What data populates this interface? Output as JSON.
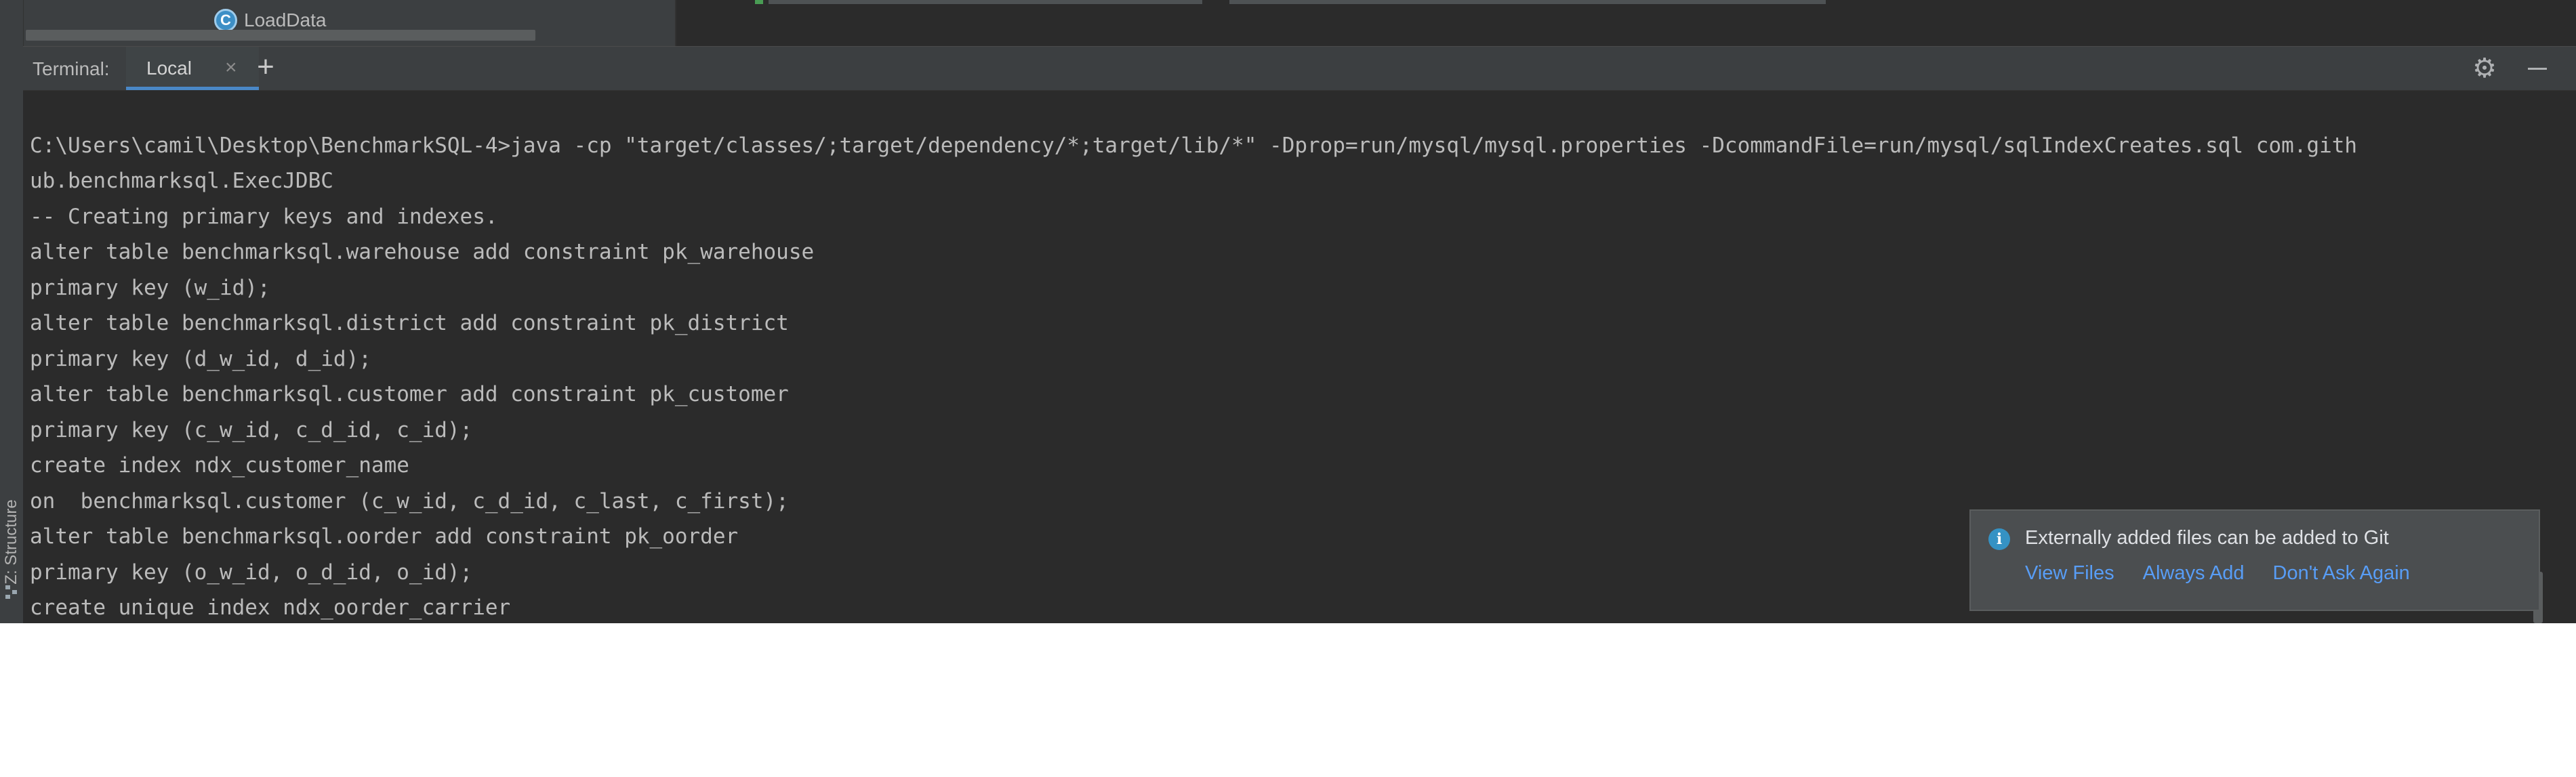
{
  "project_tree": {
    "item_label": "LoadData",
    "item_icon": "class-icon"
  },
  "tool_window": {
    "title": "Terminal:",
    "tabs": [
      {
        "label": "Local",
        "close_glyph": "×"
      }
    ],
    "add_tab_glyph": "+",
    "settings_icon": "gear-icon",
    "minimize_icon": "minimize-icon"
  },
  "terminal": {
    "lines": [
      "C:\\Users\\camil\\Desktop\\BenchmarkSQL-4>java -cp \"target/classes/;target/dependency/*;target/lib/*\" -Dprop=run/mysql/mysql.properties -DcommandFile=run/mysql/sqlIndexCreates.sql com.gith",
      "ub.benchmarksql.ExecJDBC",
      "-- Creating primary keys and indexes.",
      "alter table benchmarksql.warehouse add constraint pk_warehouse",
      "primary key (w_id);",
      "alter table benchmarksql.district add constraint pk_district",
      "primary key (d_w_id, d_id);",
      "alter table benchmarksql.customer add constraint pk_customer",
      "primary key (c_w_id, c_d_id, c_id);",
      "create index ndx_customer_name",
      "on  benchmarksql.customer (c_w_id, c_d_id, c_last, c_first);",
      "alter table benchmarksql.oorder add constraint pk_oorder",
      "primary key (o_w_id, o_d_id, o_id);",
      "create unique index ndx_oorder_carrier"
    ]
  },
  "side_panel": {
    "structure_label": "Z: Structure"
  },
  "notification": {
    "icon": "info-icon",
    "message": "Externally added files can be added to Git",
    "actions": [
      "View Files",
      "Always Add",
      "Don't Ask Again"
    ]
  },
  "colors": {
    "background": "#2b2b2b",
    "panel": "#3c3f41",
    "accent": "#4a88c7",
    "link": "#589df6",
    "text": "#bbbbbb"
  }
}
